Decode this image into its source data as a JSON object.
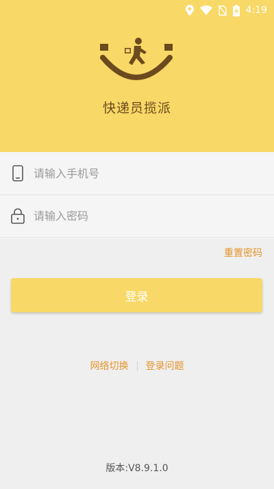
{
  "status_bar": {
    "time": "4:19",
    "icons": [
      "location-icon",
      "wifi-icon",
      "no-sim-icon",
      "battery-charging-icon"
    ]
  },
  "header": {
    "app_title": "快递员揽派",
    "logo": "courier-smile-logo"
  },
  "form": {
    "phone": {
      "placeholder": "请输入手机号",
      "value": "",
      "icon": "phone-icon"
    },
    "password": {
      "placeholder": "请输入密码",
      "value": "",
      "icon": "lock-icon"
    },
    "reset_password": "重置密码",
    "login_button": "登录"
  },
  "links": {
    "network_switch": "网络切换",
    "login_issues": "登录问题"
  },
  "footer": {
    "version": "版本:V8.9.1.0"
  },
  "colors": {
    "brand_yellow": "#f8d866",
    "accent_orange": "#e3962b",
    "brown": "#6b4a1e",
    "background": "#efefef"
  }
}
